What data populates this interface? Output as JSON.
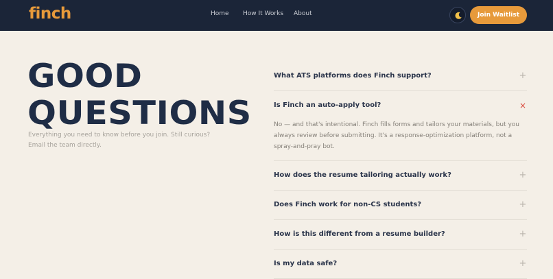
{
  "nav": {
    "logo": "finch",
    "links": [
      "Home",
      "How It Works",
      "About"
    ],
    "theme_icon": "moon-icon",
    "cta": "Join Waitlist"
  },
  "hero": {
    "title_line1": "GOOD",
    "title_line2": "QUESTIONS",
    "subtitle": "Everything you need to know before you join. Still curious? Email the team directly."
  },
  "faq": {
    "items": [
      {
        "q": "What ATS platforms does Finch support?",
        "icon": "+"
      },
      {
        "q": "Is Finch an auto-apply tool?",
        "icon": "×",
        "a": "No — and that's intentional. Finch fills forms and tailors your materials, but you always review before submitting. It's a response-optimization platform, not a spray-and-pray bot."
      },
      {
        "q": "How does the resume tailoring actually work?",
        "icon": "+"
      },
      {
        "q": "Does Finch work for non-CS students?",
        "icon": "+"
      },
      {
        "q": "How is this different from a resume builder?",
        "icon": "+"
      },
      {
        "q": "Is my data safe?",
        "icon": "+"
      }
    ]
  },
  "colors": {
    "navbar": "#1b2538",
    "accent": "#e79a3b",
    "background": "#f4efe7",
    "heading": "#1f2d46",
    "close_icon": "#d9483b"
  }
}
